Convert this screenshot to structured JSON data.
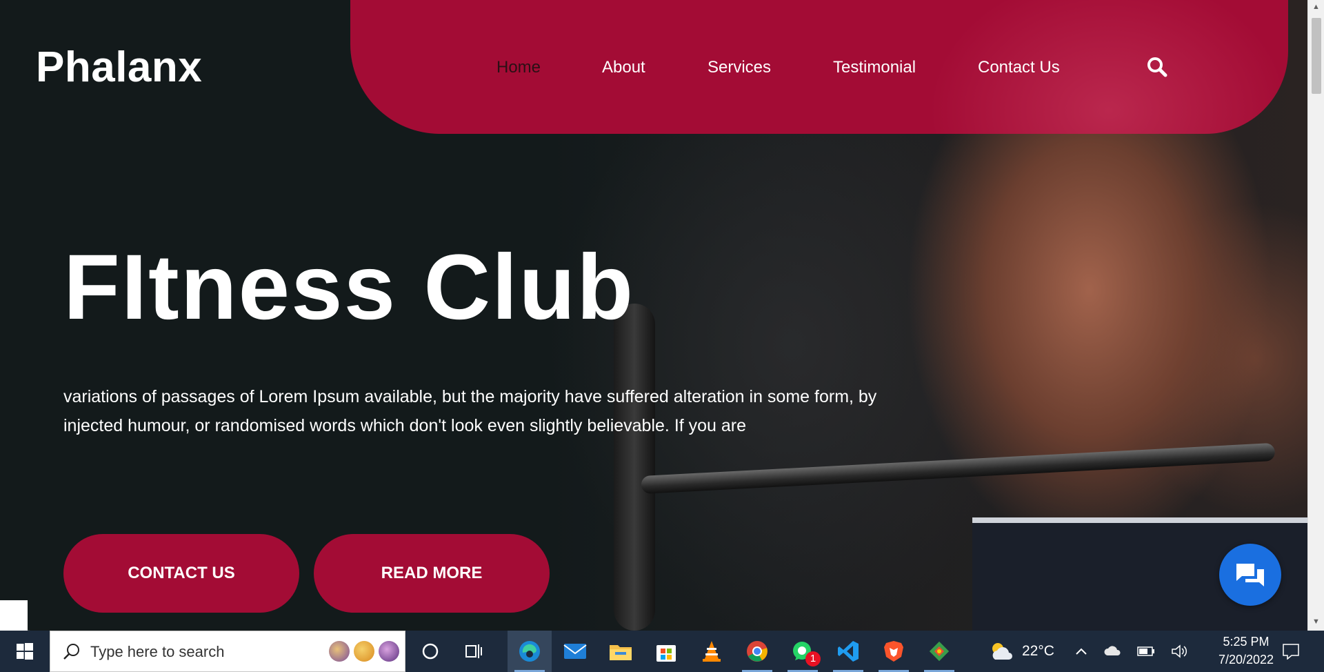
{
  "site": {
    "logo": "Phalanx",
    "nav": [
      {
        "label": "Home",
        "active": true
      },
      {
        "label": "About"
      },
      {
        "label": "Services"
      },
      {
        "label": "Testimonial"
      },
      {
        "label": "Contact Us"
      }
    ],
    "hero": {
      "title": "FItness Club",
      "text": "variations of passages of Lorem Ipsum available, but the majority have suffered alteration in some form, by injected humour, or randomised words which don't look even slightly believable. If you are",
      "primary_button": "CONTACT US",
      "secondary_button": "READ MORE"
    },
    "colors": {
      "accent": "#a30c35",
      "dark_bg": "#131a1b",
      "chat": "#1a6fe0"
    }
  },
  "taskbar": {
    "search_placeholder": "Type here to search",
    "weather_temp": "22°C",
    "time": "5:25 PM",
    "date": "7/20/2022",
    "pinned": [
      "task-view",
      "edge",
      "mail",
      "file-explorer",
      "microsoft-store",
      "vlc",
      "chrome",
      "whatsapp",
      "vscode",
      "brave",
      "git-gui"
    ],
    "whatsapp_badge": "1"
  }
}
